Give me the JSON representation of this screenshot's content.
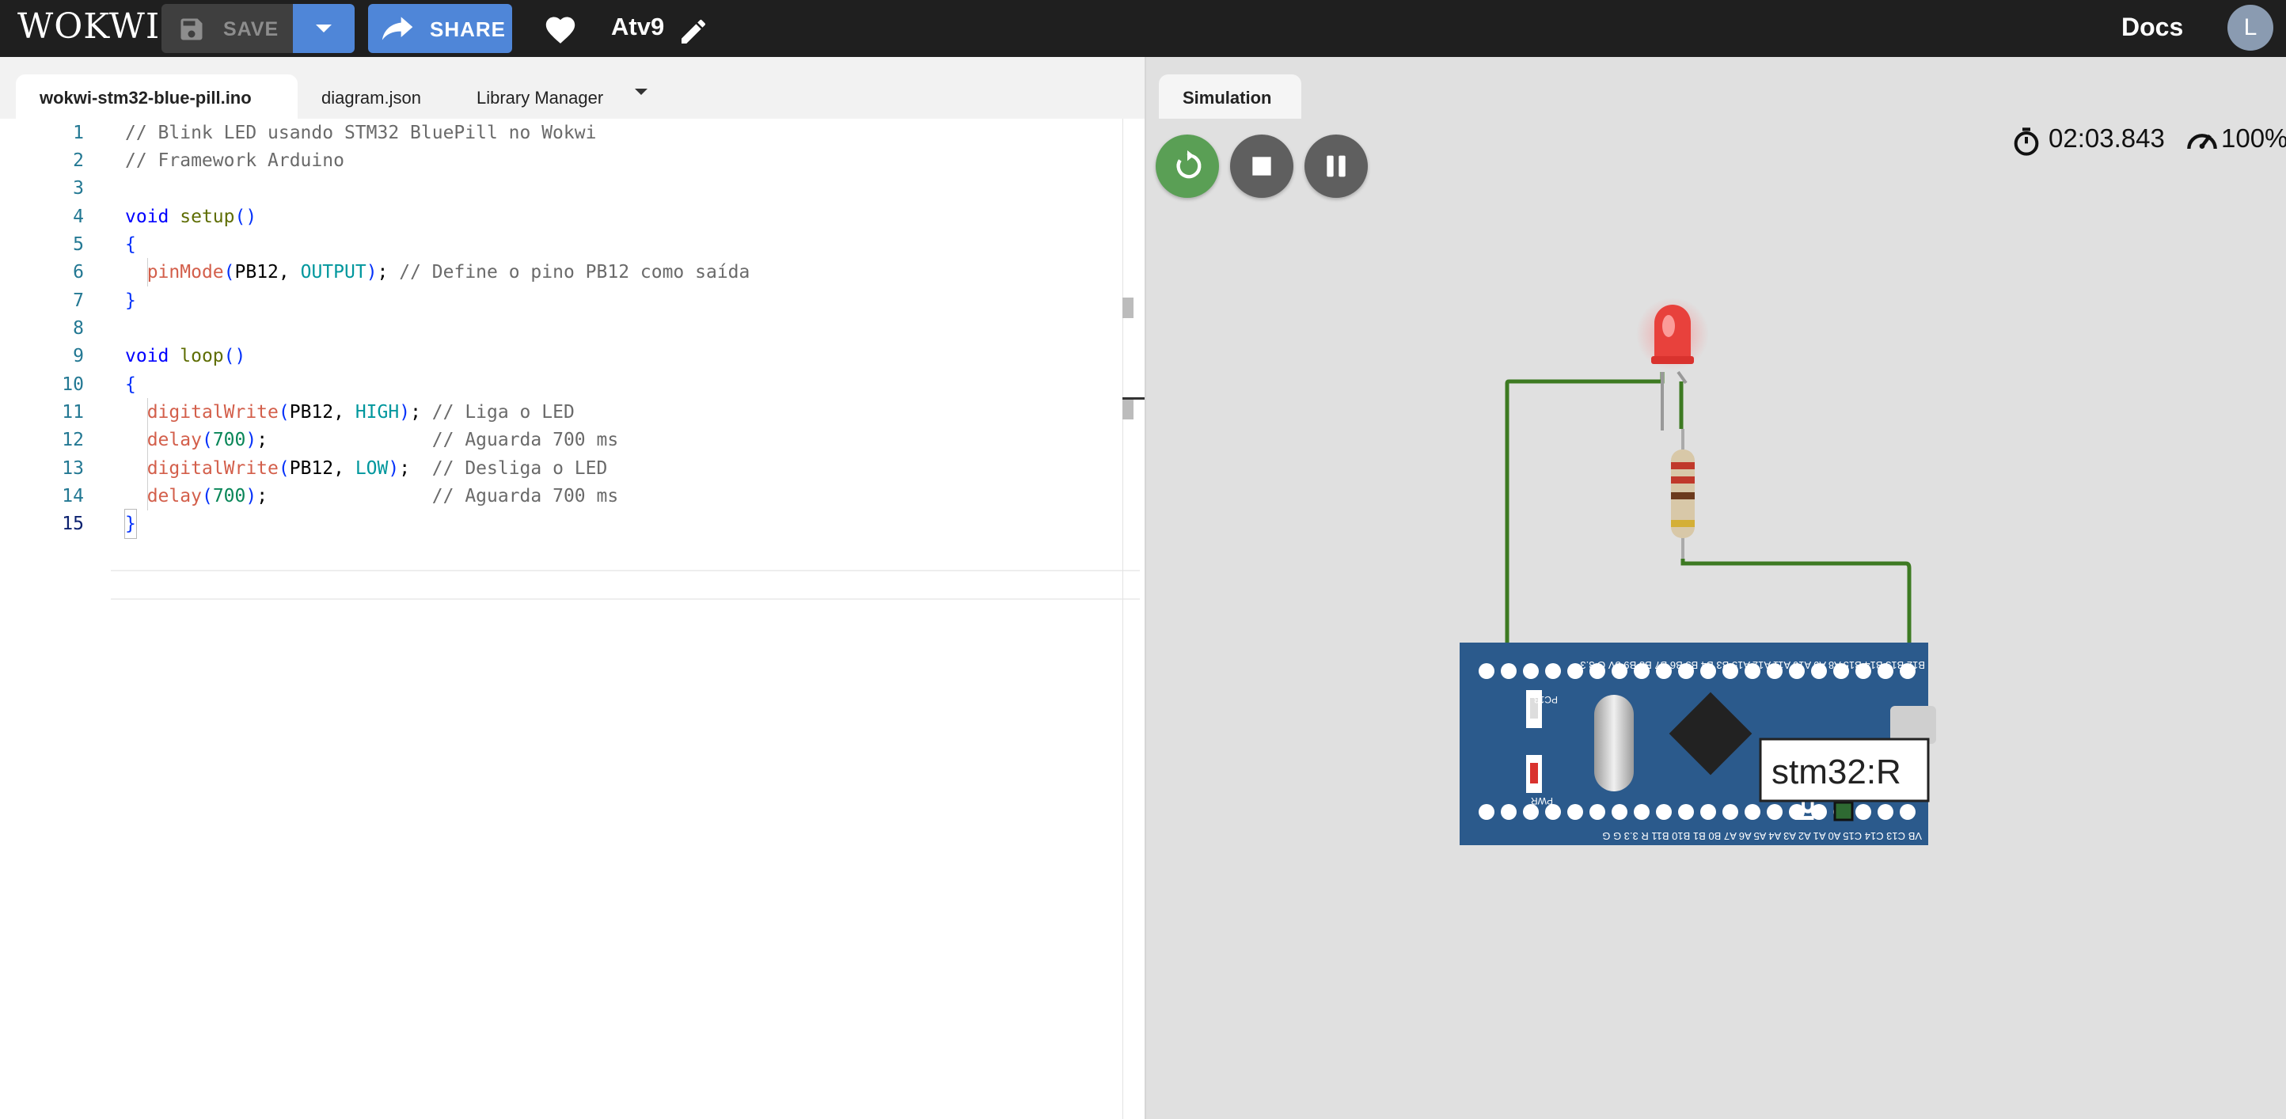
{
  "header": {
    "logo": "WOKWI",
    "save_label": "SAVE",
    "share_label": "SHARE",
    "project_name": "Atv9",
    "docs_label": "Docs",
    "avatar_initial": "L"
  },
  "editor": {
    "tabs": [
      {
        "label": "wokwi-stm32-blue-pill.ino"
      },
      {
        "label": "diagram.json"
      },
      {
        "label": "Library Manager"
      }
    ],
    "line_numbers": [
      "1",
      "2",
      "3",
      "4",
      "5",
      "6",
      "7",
      "8",
      "9",
      "10",
      "11",
      "12",
      "13",
      "14",
      "15"
    ],
    "lines": [
      "// Blink LED usando STM32 BluePill no Wokwi",
      "// Framework Arduino",
      "",
      "void setup()",
      "{",
      "  pinMode(PB12, OUTPUT); // Define o pino PB12 como saída",
      "}",
      "",
      "void loop()",
      "{",
      "  digitalWrite(PB12, HIGH); // Liga o LED",
      "  delay(700);               // Aguarda 700 ms",
      "  digitalWrite(PB12, LOW);  // Desliga o LED",
      "  delay(700);               // Aguarda 700 ms",
      "}"
    ]
  },
  "simulation": {
    "tab_label": "Simulation",
    "timer": "02:03.843",
    "speed": "100%",
    "board_tooltip": "stm32:R",
    "board_silk_top": "B12 B13 B14 B15 A8 A9 A10 A11 A12 A15 B3 B4 B5 B6 B7 B8 B9 5V G 3.3",
    "board_silk_bottom": "VB C13 C14 C15 A0 A1 A2 A3 A4 A5 A6 A7 B0 B1 B10 B11 R 3.3 G G",
    "board_label_pc13": "PC13",
    "board_label_pwr": "PWR",
    "board_label_name": "BL PI"
  },
  "colors": {
    "topbar": "#1f1f1f",
    "accent": "#4f86d8",
    "restart": "#5a9f55",
    "wire": "#3d7a22",
    "board": "#2b5a8c",
    "led": "#e8413c"
  }
}
